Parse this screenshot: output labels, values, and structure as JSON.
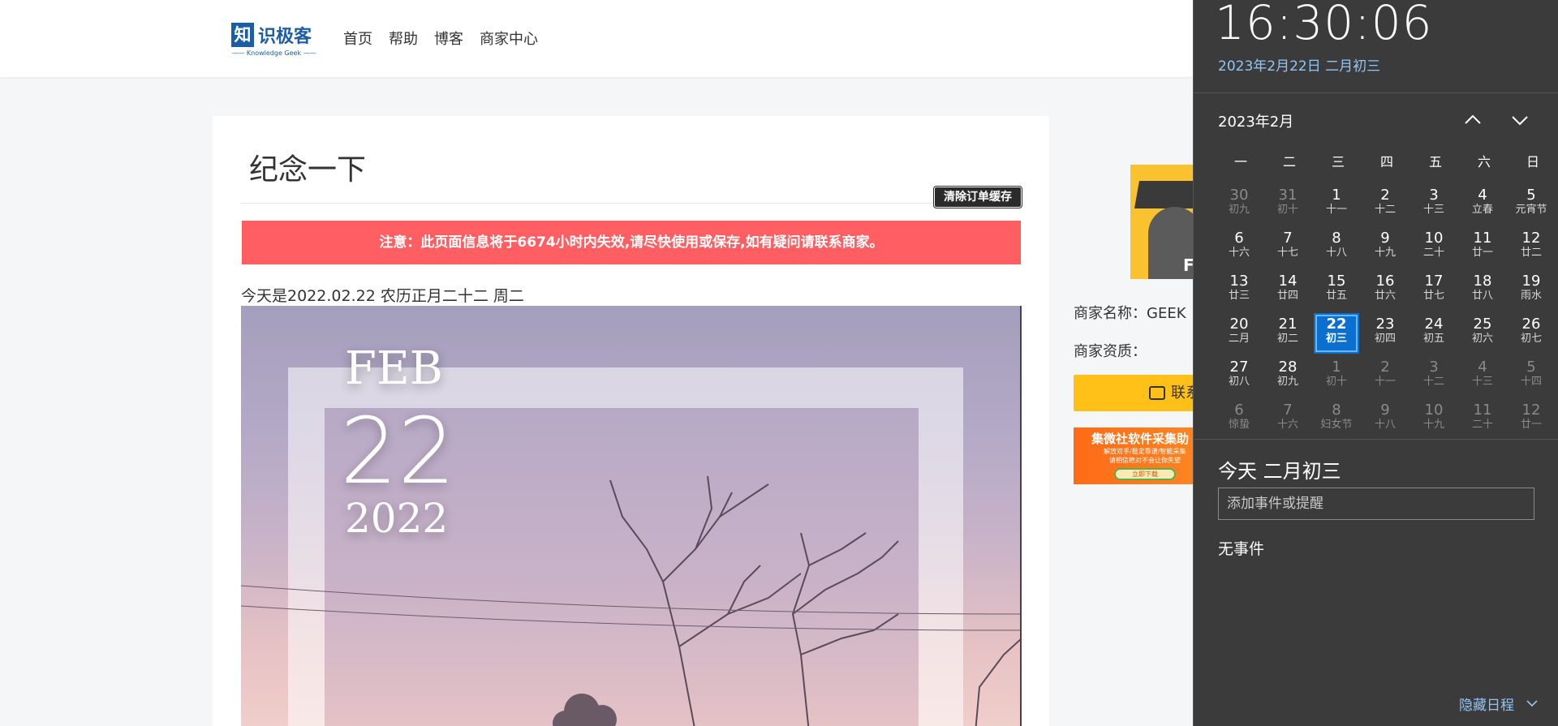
{
  "header": {
    "logo": {
      "mark": "知",
      "name": "识极客",
      "sub": "—— Knowledge Geek ——"
    },
    "nav": [
      "首页",
      "帮助",
      "博客",
      "商家中心"
    ]
  },
  "main": {
    "title": "纪念一下",
    "clear_cache_button": "清除订单缓存",
    "notice": "注意：此页面信息将于6674小时内失效,请尽快使用或保存,如有疑问请联系商家。",
    "today_line": "今天是2022.02.22 农历正月二十二 周二",
    "photo": {
      "month": "FEB",
      "day": "22",
      "year": "2022"
    }
  },
  "merchant": {
    "name_label": "商家名称：GEEK",
    "qualification_label": "商家资质：",
    "avatar_letter": "F",
    "contact_button": "联系",
    "ad": {
      "title": "集微社软件采集助",
      "line1": "解放双手/稳定靠谱/智能采集",
      "line2": "请相信绝对不会让你失望",
      "button": "立即下载"
    }
  },
  "flyout": {
    "time": "16:30:06",
    "date": "2023年2月22日 二月初三",
    "month_title": "2023年2月",
    "weekdays": [
      "一",
      "二",
      "三",
      "四",
      "五",
      "六",
      "日"
    ],
    "weeks": [
      [
        {
          "n": "30",
          "l": "初九",
          "o": true
        },
        {
          "n": "31",
          "l": "初十",
          "o": true
        },
        {
          "n": "1",
          "l": "十一"
        },
        {
          "n": "2",
          "l": "十二"
        },
        {
          "n": "3",
          "l": "十三"
        },
        {
          "n": "4",
          "l": "立春"
        },
        {
          "n": "5",
          "l": "元宵节"
        }
      ],
      [
        {
          "n": "6",
          "l": "十六"
        },
        {
          "n": "7",
          "l": "十七"
        },
        {
          "n": "8",
          "l": "十八"
        },
        {
          "n": "9",
          "l": "十九"
        },
        {
          "n": "10",
          "l": "二十"
        },
        {
          "n": "11",
          "l": "廿一"
        },
        {
          "n": "12",
          "l": "廿二"
        }
      ],
      [
        {
          "n": "13",
          "l": "廿三"
        },
        {
          "n": "14",
          "l": "廿四"
        },
        {
          "n": "15",
          "l": "廿五"
        },
        {
          "n": "16",
          "l": "廿六"
        },
        {
          "n": "17",
          "l": "廿七"
        },
        {
          "n": "18",
          "l": "廿八"
        },
        {
          "n": "19",
          "l": "雨水"
        }
      ],
      [
        {
          "n": "20",
          "l": "二月"
        },
        {
          "n": "21",
          "l": "初二"
        },
        {
          "n": "22",
          "l": "初三",
          "t": true
        },
        {
          "n": "23",
          "l": "初四"
        },
        {
          "n": "24",
          "l": "初五"
        },
        {
          "n": "25",
          "l": "初六"
        },
        {
          "n": "26",
          "l": "初七"
        }
      ],
      [
        {
          "n": "27",
          "l": "初八"
        },
        {
          "n": "28",
          "l": "初九"
        },
        {
          "n": "1",
          "l": "初十",
          "o": true
        },
        {
          "n": "2",
          "l": "十一",
          "o": true
        },
        {
          "n": "3",
          "l": "十二",
          "o": true
        },
        {
          "n": "4",
          "l": "十三",
          "o": true
        },
        {
          "n": "5",
          "l": "十四",
          "o": true
        }
      ],
      [
        {
          "n": "6",
          "l": "惊蛰",
          "o": true
        },
        {
          "n": "7",
          "l": "十六",
          "o": true
        },
        {
          "n": "8",
          "l": "妇女节",
          "o": true
        },
        {
          "n": "9",
          "l": "十八",
          "o": true
        },
        {
          "n": "10",
          "l": "十九",
          "o": true
        },
        {
          "n": "11",
          "l": "二十",
          "o": true
        },
        {
          "n": "12",
          "l": "廿一",
          "o": true
        }
      ]
    ],
    "today_heading": "今天 二月初三",
    "event_placeholder": "添加事件或提醒",
    "no_events": "无事件",
    "hide_agenda": "隐藏日程",
    "colors": {
      "accent": "#0b6fd0",
      "link": "#8fc6f5",
      "background": "#3b3b3b"
    }
  }
}
